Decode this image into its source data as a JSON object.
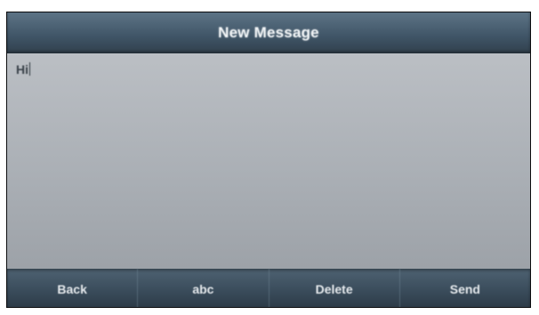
{
  "screen": {
    "title": "New Message",
    "message": {
      "text": "Hi"
    },
    "softkeys": [
      {
        "label": "Back"
      },
      {
        "label": "abc"
      },
      {
        "label": "Delete"
      },
      {
        "label": "Send"
      }
    ]
  }
}
